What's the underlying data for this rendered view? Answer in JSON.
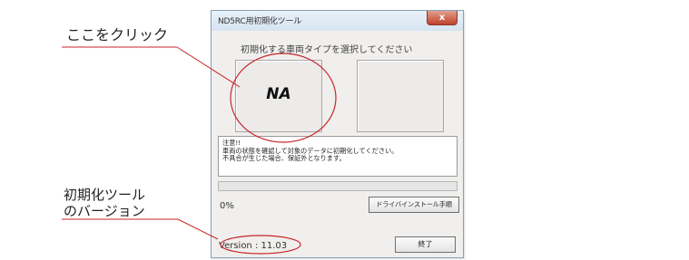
{
  "annotations": {
    "click_here": "ここをクリック",
    "version_line1": "初期化ツール",
    "version_line2": "のバージョン"
  },
  "dialog": {
    "title": "ND5RC用初期化ツール",
    "close_label": "x",
    "instruction": "初期化する車両タイプを選択してください",
    "vehicle_buttons": [
      {
        "label": "NA"
      },
      {
        "label": ""
      }
    ],
    "notice_lines": [
      "注意!!",
      "車両の状態を確認して対象のデータに初期化してください。",
      "不具合が生じた場合、保証外となります。"
    ],
    "progress_percent_text": "0%",
    "progress_value": 0,
    "driver_install_label": "ドライバインストール手順",
    "version_text": "Version : 11.03",
    "exit_label": "終了"
  },
  "colors": {
    "annotation_red": "#c8252b",
    "progress_green": "#4fae4f",
    "titlebar": "#dce7f3"
  }
}
